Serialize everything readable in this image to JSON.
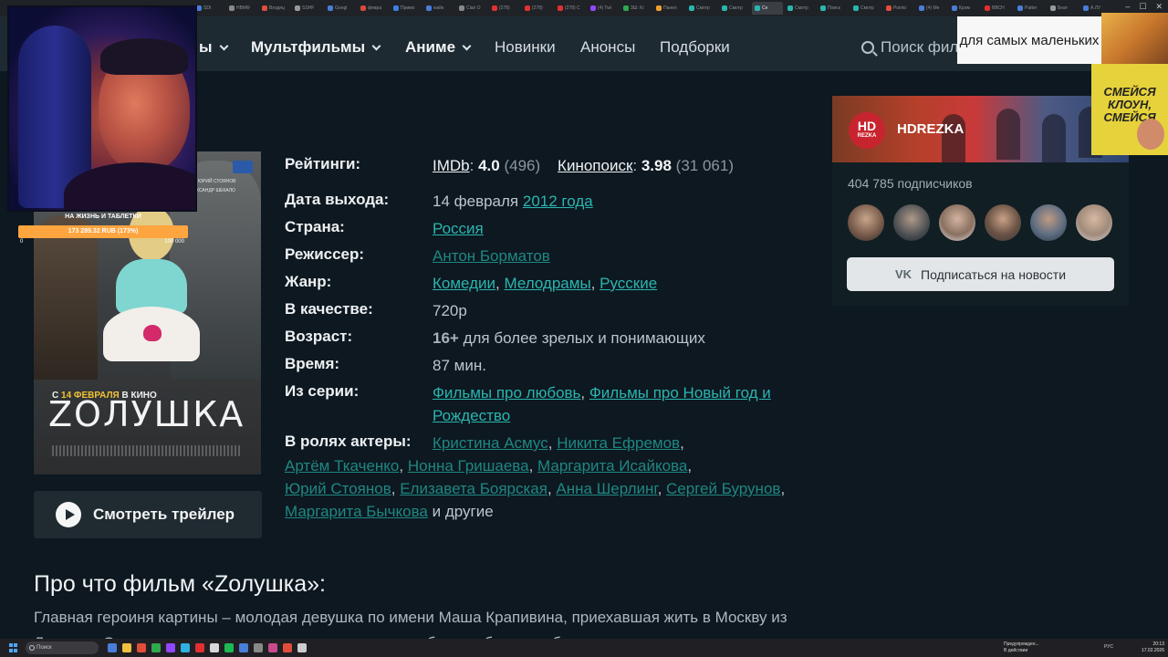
{
  "browser": {
    "tabs": [
      {
        "label": "SDI",
        "color": "#4a7dd8",
        "active": false
      },
      {
        "label": "НВМФ",
        "color": "#8a8a8a",
        "active": false
      },
      {
        "label": "Входяц",
        "color": "#e04e3a",
        "active": false
      },
      {
        "label": "SSHF",
        "color": "#999999",
        "active": false
      },
      {
        "label": "Googl",
        "color": "#4a7dd8",
        "active": false
      },
      {
        "label": "февра",
        "color": "#d64a3a",
        "active": false
      },
      {
        "label": "Примо",
        "color": "#3f7fe0",
        "active": false
      },
      {
        "label": "walle",
        "color": "#4a7dd8",
        "active": false
      },
      {
        "label": "Clair O",
        "color": "#888888",
        "active": false
      },
      {
        "label": "(278)",
        "color": "#e23030",
        "active": false
      },
      {
        "label": "(278)",
        "color": "#e23030",
        "active": false
      },
      {
        "label": "(278) C",
        "color": "#e23030",
        "active": false
      },
      {
        "label": "(4) Twi",
        "color": "#9146ff",
        "active": false
      },
      {
        "label": "3Ш: Ki",
        "color": "#2fa84f",
        "active": false
      },
      {
        "label": "Панел",
        "color": "#f0a030",
        "active": false
      },
      {
        "label": "Смотр",
        "color": "#2bb5b0",
        "active": false
      },
      {
        "label": "Смотр",
        "color": "#2bb5b0",
        "active": false
      },
      {
        "label": "Сe",
        "color": "#2bb5b0",
        "active": true
      },
      {
        "label": "Смотр",
        "color": "#2bb5b0",
        "active": false
      },
      {
        "label": "Поиск",
        "color": "#2bb5b0",
        "active": false
      },
      {
        "label": "Смотр",
        "color": "#2bb5b0",
        "active": false
      },
      {
        "label": "Pointo",
        "color": "#e04e3a",
        "active": false
      },
      {
        "label": "(4) Me",
        "color": "#4a7dd8",
        "active": false
      },
      {
        "label": "Кром",
        "color": "#4a7dd8",
        "active": false
      },
      {
        "label": "ВВСН",
        "color": "#e23030",
        "active": false
      },
      {
        "label": "Patter",
        "color": "#4a7dd8",
        "active": false
      },
      {
        "label": "Беат",
        "color": "#999999",
        "active": false
      },
      {
        "label": "A.ЛУ",
        "color": "#4a7dd8",
        "active": false
      }
    ]
  },
  "nav": {
    "items": [
      {
        "label": "ы",
        "dropdown": true,
        "bold": true
      },
      {
        "label": "Мультфильмы",
        "dropdown": true,
        "bold": true
      },
      {
        "label": "Аниме",
        "dropdown": true,
        "bold": true
      },
      {
        "label": "Новинки",
        "dropdown": false,
        "bold": false
      },
      {
        "label": "Анонсы",
        "dropdown": false,
        "bold": false
      },
      {
        "label": "Подборки",
        "dropdown": false,
        "bold": false
      }
    ],
    "search_placeholder": "Поиск фил"
  },
  "poster": {
    "title": "ZОЛУШКА",
    "date_prefix": "С",
    "date_highlight": "14 ФЕВРАЛЯ",
    "date_suffix": "В КИНО",
    "actor_top_right_1": "ЮРИЙ СТОЯНОВ",
    "actor_top_right_2": "АЛЕКСАНДР ШЕКАЛО"
  },
  "donation": {
    "title": "НА ЖИЗНЬ И ТАБЛЕТКИ",
    "amount": "173 289.32 RUB (173%)",
    "min": "0",
    "max": "100 000",
    "progress_percent": 173
  },
  "trailer": {
    "label": "Смотреть трейлер"
  },
  "info": {
    "ratings_label": "Рейтинги:",
    "imdb_name": "IMDb",
    "imdb_score": "4.0",
    "imdb_votes": "(496)",
    "kp_name": "Кинопоиск",
    "kp_score": "3.98",
    "kp_votes": "(31 061)",
    "release_label": "Дата выхода:",
    "release_day": "14 февраля",
    "release_year": "2012 года",
    "country_label": "Страна:",
    "country": "Россия",
    "director_label": "Режиссер:",
    "director": "Антон Борматов",
    "genre_label": "Жанр:",
    "genres": [
      "Комедии",
      "Мелодрамы",
      "Русские"
    ],
    "quality_label": "В качестве:",
    "quality": "720p",
    "age_label": "Возраст:",
    "age_rating": "16+",
    "age_text": "для более зрелых и понимающих",
    "time_label": "Время:",
    "time": "87 мин.",
    "series_label": "Из серии:",
    "series_1": "Фильмы про любовь",
    "series_2": "Фильмы про Новый год и",
    "series_2b": "Рождество",
    "cast_label": "В ролях актеры:",
    "cast": [
      "Кристина Асмус",
      "Никита Ефремов",
      "Артём Ткаченко",
      "Нонна Гришаева",
      "Маргарита Исайкова",
      "Юрий Стоянов",
      "Елизавета Боярская",
      "Анна Шерлинг",
      "Сергей Бурунов",
      "Маргарита Бычкова"
    ],
    "cast_more": "и другие"
  },
  "about": {
    "title": "Про что фильм «Zолушка»:",
    "text": "Главная героиня картины – молодая девушка по имени Маша Крапивина, приехавшая жить в Москву из Липецка. Она поступает в университет, а для того, чтобы заработать себе на проживание, вынуждена..."
  },
  "vk": {
    "logo_main": "HD",
    "logo_sub": "REZKA",
    "name": "HDREZKA",
    "subscribers": "404 785 подписчиков",
    "button_glyph": "VK",
    "button_label": "Подписаться на новости"
  },
  "overlays": {
    "text_box": "для самых маленьких",
    "poster_text": "СМЕЙСЯ КЛОУН, СМЕЙСЯ"
  },
  "taskbar": {
    "search_label": "Поиск",
    "weather_line1": "Предупрежден...",
    "weather_line2": "В действии",
    "tray_lang": "РУС",
    "clock_time": "20:13",
    "clock_date": "17.02.2026"
  }
}
